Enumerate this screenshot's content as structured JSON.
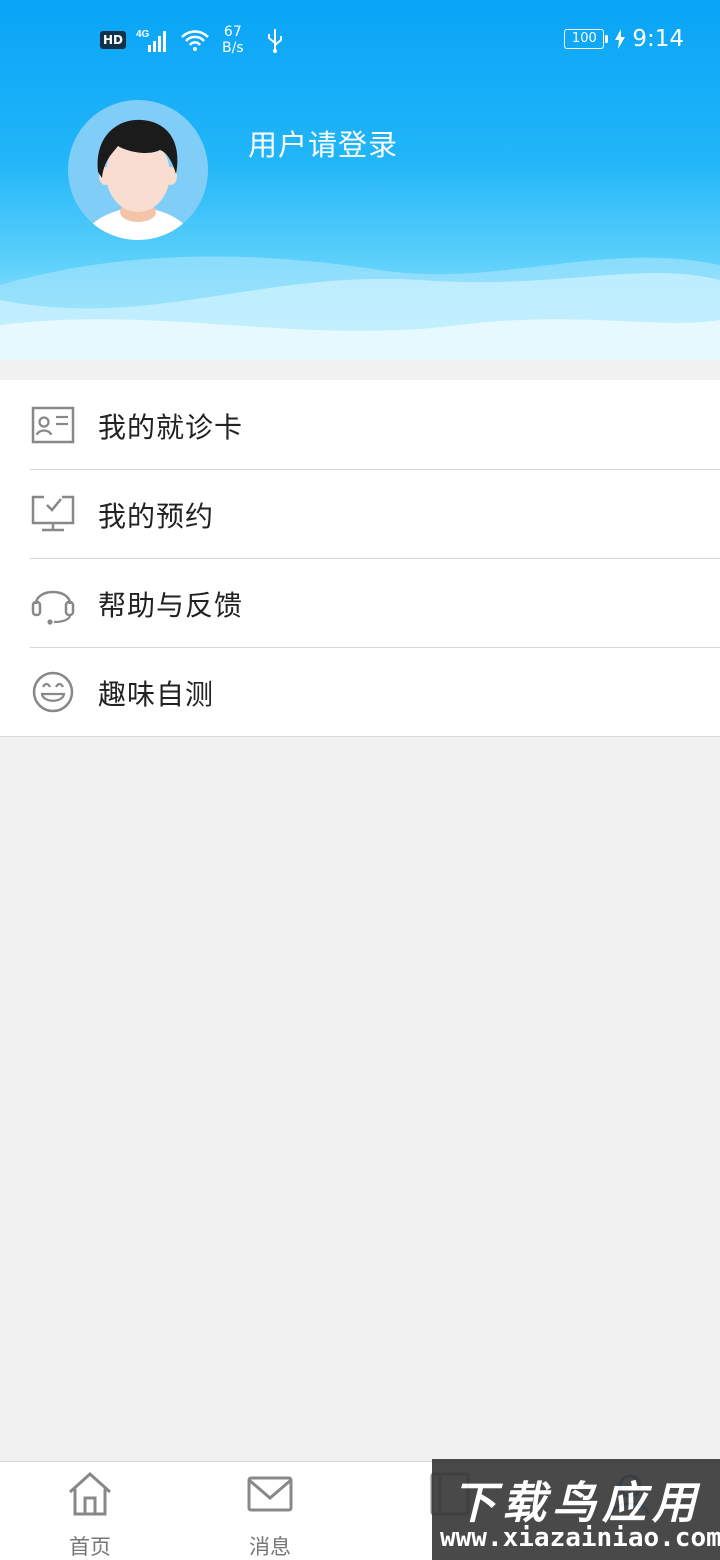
{
  "status_bar": {
    "network_badge": "HD",
    "network_type": "4G",
    "net_speed_value": "67",
    "net_speed_unit": "B/s",
    "battery": "100",
    "time": "9:14"
  },
  "profile": {
    "login_prompt": "用户请登录"
  },
  "menu": {
    "items": [
      {
        "label": "我的就诊卡",
        "icon": "id-card-icon"
      },
      {
        "label": "我的预约",
        "icon": "monitor-check-icon"
      },
      {
        "label": "帮助与反馈",
        "icon": "headset-icon"
      },
      {
        "label": "趣味自测",
        "icon": "smiley-icon"
      }
    ]
  },
  "tabbar": {
    "tabs": [
      {
        "label": "首页",
        "icon": "home-icon"
      },
      {
        "label": "消息",
        "icon": "mail-icon"
      },
      {
        "label": "",
        "icon": "book-icon"
      },
      {
        "label": "",
        "icon": "user-icon"
      }
    ]
  },
  "watermark": {
    "title": "下载鸟应用",
    "url": "www.xiazainiao.com"
  },
  "colors": {
    "header_top": "#08a4f7",
    "header_bottom": "#c7f0fd",
    "icon_gray": "#888888",
    "page_bg": "#f1f1f1"
  }
}
